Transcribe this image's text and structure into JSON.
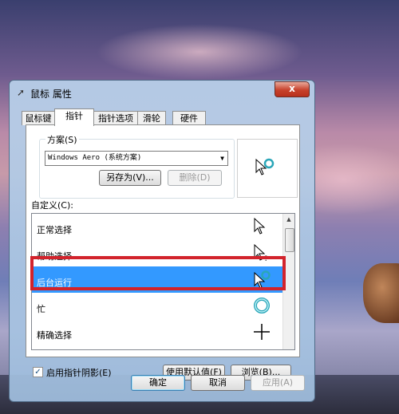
{
  "dialog": {
    "title": "鼠标 属性",
    "close_label": "x"
  },
  "tabs": [
    {
      "label": "鼠标键"
    },
    {
      "label": "指针"
    },
    {
      "label": "指针选项"
    },
    {
      "label": "滑轮"
    },
    {
      "label": "硬件"
    }
  ],
  "scheme": {
    "group_label": "方案(S)",
    "selected": "Windows Aero (系统方案)",
    "save_as_label": "另存为(V)...",
    "delete_label": "删除(D)"
  },
  "customize": {
    "label": "自定义(C):",
    "items": [
      {
        "label": "正常选择",
        "icon": "arrow-cursor-icon"
      },
      {
        "label": "帮助选择",
        "icon": "help-cursor-icon"
      },
      {
        "label": "后台运行",
        "icon": "busy-arrow-cursor-icon"
      },
      {
        "label": "忙",
        "icon": "busy-ring-cursor-icon"
      },
      {
        "label": "精确选择",
        "icon": "precision-cursor-icon"
      }
    ]
  },
  "shadow": {
    "label": "启用指针阴影(E)",
    "checked": true
  },
  "buttons": {
    "use_default": "使用默认值(F)",
    "browse": "浏览(B)...",
    "ok": "确定",
    "cancel": "取消",
    "apply": "应用(A)"
  },
  "colors": {
    "selection": "#3399ff",
    "highlight_border": "#d2232c",
    "busy_ring": "#2aa6b8"
  }
}
